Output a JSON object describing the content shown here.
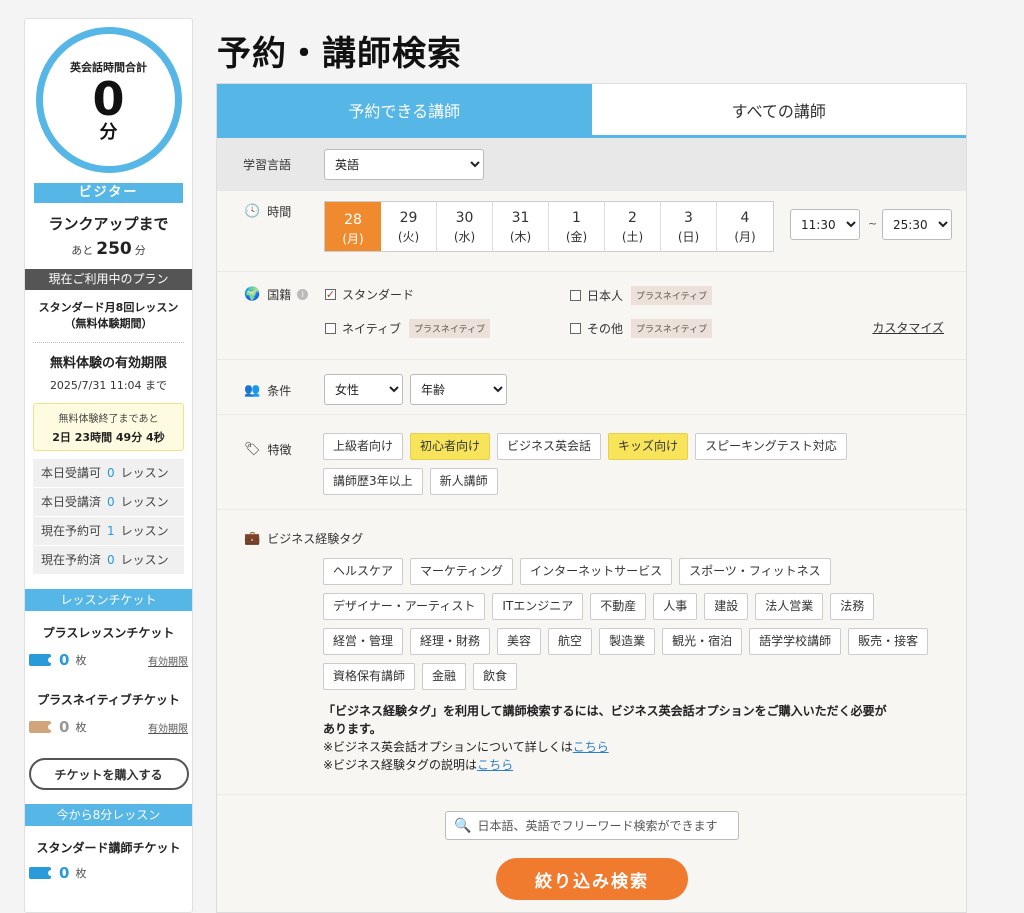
{
  "sidebar": {
    "ring_label": "英会話時間合計",
    "ring_value": "0",
    "ring_unit": "分",
    "rank": "ビジター",
    "rankup_title": "ランクアップまで",
    "rankup_prefix": "あと",
    "rankup_value": "250",
    "rankup_unit": "分",
    "plan_head": "現在ご利用中のプラン",
    "plan_name_1": "スタンダード月8回レッスン",
    "plan_name_2": "（無料体験期間）",
    "trial_title": "無料体験の有効期限",
    "trial_date": "2025/7/31 11:04 まで",
    "countdown_label": "無料体験終了まであと",
    "countdown_value": "2日 23時間 49分 4秒",
    "stats": [
      {
        "label": "本日受講可",
        "value": "0",
        "unit": "レッスン"
      },
      {
        "label": "本日受講済",
        "value": "0",
        "unit": "レッスン"
      },
      {
        "label": "現在予約可",
        "value": "1",
        "unit": "レッスン"
      },
      {
        "label": "現在予約済",
        "value": "0",
        "unit": "レッスン"
      }
    ],
    "ticket_head": "レッスンチケット",
    "plus_lesson_title": "プラスレッスンチケット",
    "plus_lesson_count": "0",
    "plus_lesson_unit": "枚",
    "plus_lesson_link": "有効期限",
    "plus_native_title": "プラスネイティブチケット",
    "plus_native_count": "0",
    "plus_native_unit": "枚",
    "plus_native_link": "有効期限",
    "buy_button": "チケットを購入する",
    "now_head": "今から8分レッスン",
    "std_title": "スタンダード講師チケット",
    "std_count": "0",
    "std_unit": "枚"
  },
  "main": {
    "title": "予約・講師検索",
    "tabs": [
      {
        "label": "予約できる講師",
        "active": true
      },
      {
        "label": "すべての講師",
        "active": false
      }
    ],
    "language_label": "学習言語",
    "language_value": "英語",
    "time_label": "時間",
    "dates": [
      {
        "day": "28",
        "dow": "(月)",
        "selected": true
      },
      {
        "day": "29",
        "dow": "(火)"
      },
      {
        "day": "30",
        "dow": "(水)"
      },
      {
        "day": "31",
        "dow": "(木)"
      },
      {
        "day": "1",
        "dow": "(金)"
      },
      {
        "day": "2",
        "dow": "(土)"
      },
      {
        "day": "3",
        "dow": "(日)"
      },
      {
        "day": "4",
        "dow": "(月)"
      }
    ],
    "time_from": "11:30",
    "time_sep": "~",
    "time_to": "25:30",
    "nationality_label": "国籍",
    "nat_standard": "スタンダード",
    "nat_native": "ネイティブ",
    "nat_japanese": "日本人",
    "nat_other": "その他",
    "plus_native_tag": "プラスネイティブ",
    "customize": "カスタマイズ",
    "condition_label": "条件",
    "gender_value": "女性",
    "age_value": "年齢",
    "feature_label": "特徴",
    "features": [
      {
        "label": "上級者向け",
        "on": false
      },
      {
        "label": "初心者向け",
        "on": true
      },
      {
        "label": "ビジネス英会話",
        "on": false
      },
      {
        "label": "キッズ向け",
        "on": true
      },
      {
        "label": "スピーキングテスト対応",
        "on": false
      },
      {
        "label": "講師歴3年以上",
        "on": false
      },
      {
        "label": "新人講師",
        "on": false
      }
    ],
    "biz_label": "ビジネス経験タグ",
    "biz_tags": [
      "ヘルスケア",
      "マーケティング",
      "インターネットサービス",
      "スポーツ・フィットネス",
      "デザイナー・アーティスト",
      "ITエンジニア",
      "不動産",
      "人事",
      "建設",
      "法人営業",
      "法務",
      "経営・管理",
      "経理・財務",
      "美容",
      "航空",
      "製造業",
      "観光・宿泊",
      "語学学校講師",
      "販売・接客",
      "資格保有講師",
      "金融",
      "飲食"
    ],
    "note_line1": "「ビジネス経験タグ」を利用して講師検索するには、ビジネス英会話オプションをご購入いただく必要が",
    "note_line2": "あります。",
    "note_line3_prefix": "※ビジネス英会話オプションについて詳しくは",
    "note_line4_prefix": "※ビジネス経験タグの説明は",
    "note_link": "こちら",
    "search_placeholder": "日本語、英語でフリーワード検索ができます",
    "search_button": "絞り込み検索"
  }
}
